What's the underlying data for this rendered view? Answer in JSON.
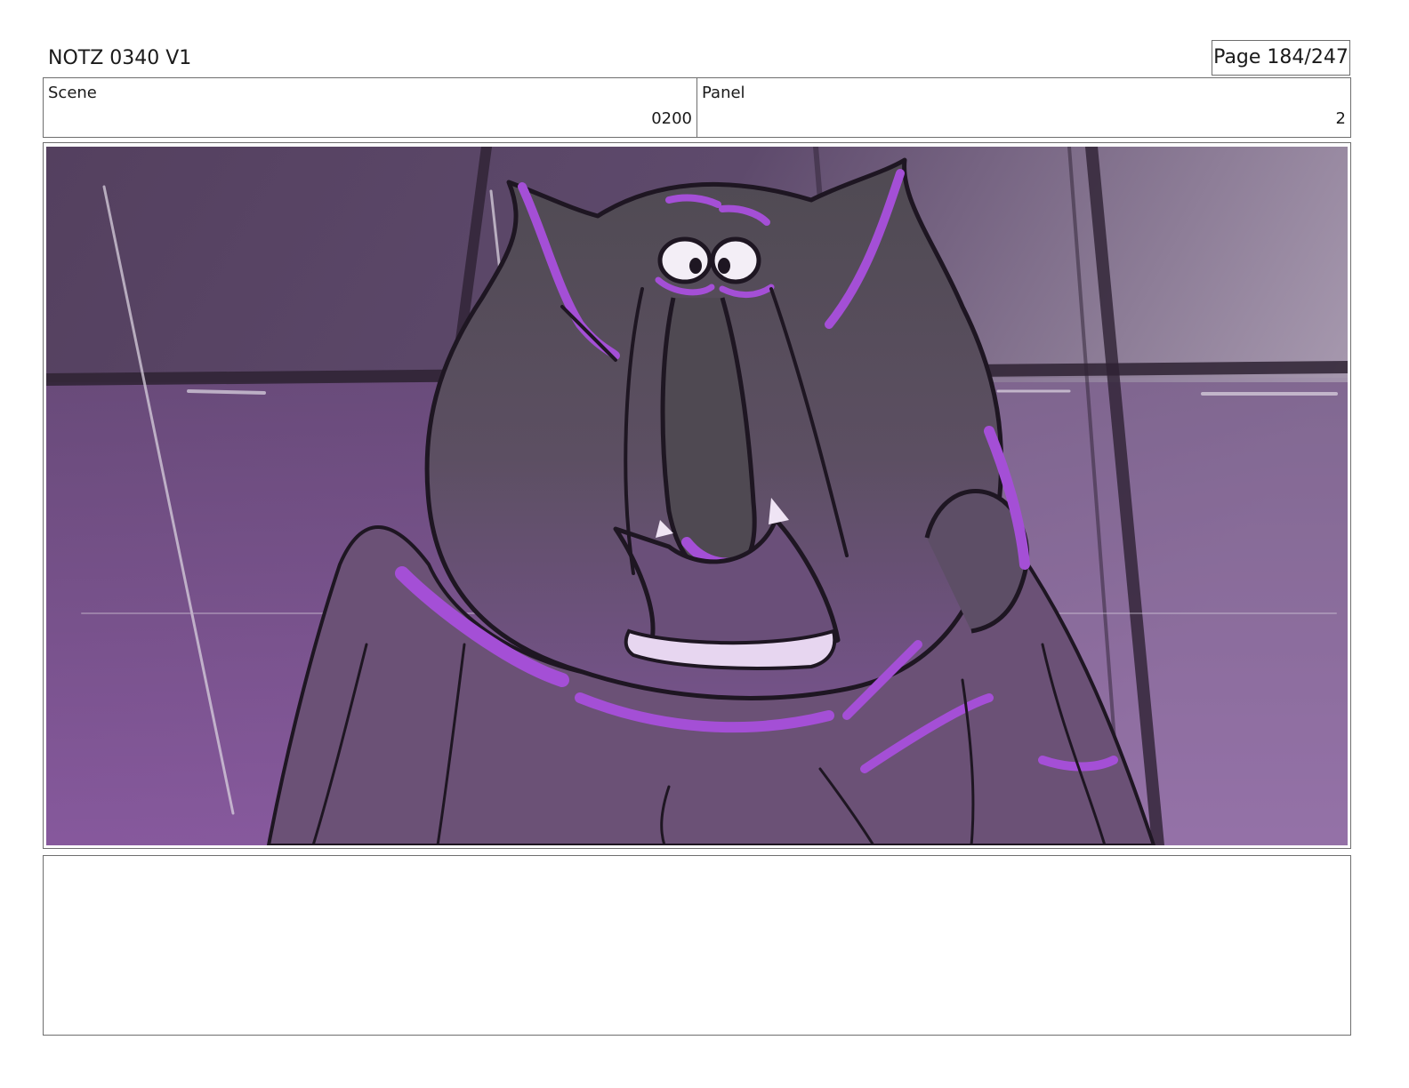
{
  "header": {
    "title": "NOTZ 0340 V1",
    "page": "Page 184/247"
  },
  "info": {
    "scene_label": "Scene",
    "scene_value": "0200",
    "panel_label": "Panel",
    "panel_value": "2"
  },
  "frame": {
    "colors": {
      "background_dark": "#5a4868",
      "background_light": "#a898b0",
      "floor_purple": "#8a5a9e",
      "character_fill": "#57505a",
      "highlight": "#a44fd6",
      "outline": "#1e1622"
    }
  },
  "notes": {
    "text": ""
  }
}
